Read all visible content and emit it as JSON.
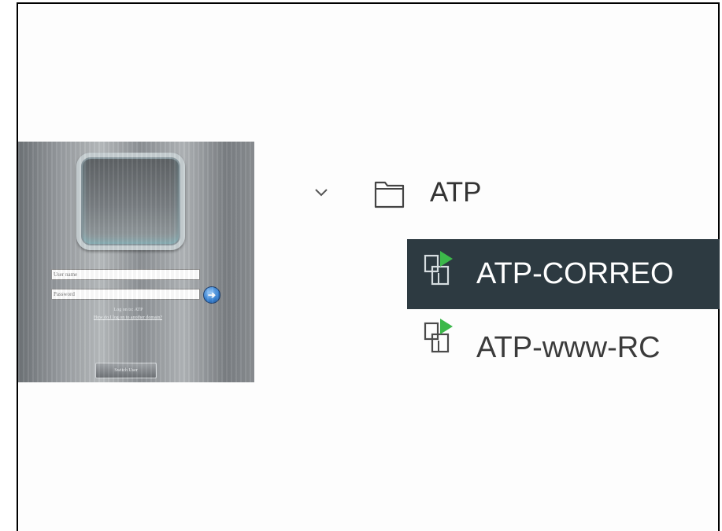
{
  "login_screen": {
    "username_placeholder": "User name",
    "password_placeholder": "Password",
    "logon_text": "Log on to: ATP",
    "other_domain_link": "How do I log on to another domain?",
    "switch_user_button": "Switch User"
  },
  "tree": {
    "folder": {
      "label": "ATP",
      "expanded": true,
      "icon": "folder-icon"
    },
    "items": [
      {
        "label": "ATP-CORREO",
        "selected": true,
        "icon": "vm-powered-on-icon"
      },
      {
        "label": "ATP-www-RC",
        "selected": false,
        "icon": "vm-powered-on-icon"
      }
    ]
  },
  "colors": {
    "selection_bg": "#2d3a41",
    "power_on_green": "#3cb84a"
  }
}
